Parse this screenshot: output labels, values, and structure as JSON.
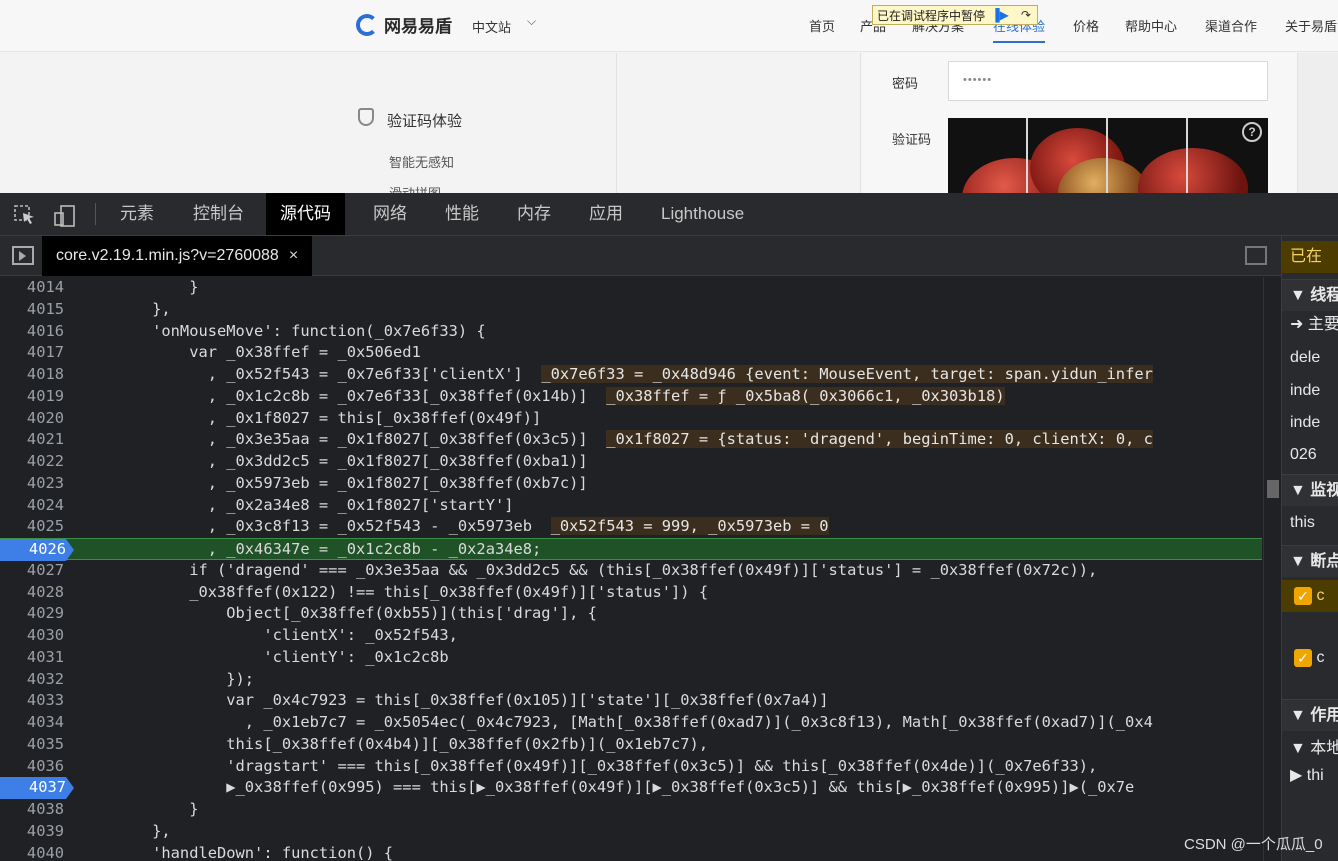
{
  "website": {
    "brand": "网易易盾",
    "lang": "中文站",
    "nav": [
      "首页",
      "产品",
      "解决方案",
      "在线体验",
      "价格",
      "帮助中心",
      "渠道合作",
      "关于易盾"
    ],
    "paused_text": "已在调试程序中暂停",
    "menu_title": "验证码体验",
    "menu_items": [
      "智能无感知",
      "滑动拼图"
    ],
    "password_label": "密码",
    "password_value": "••••••",
    "captcha_label": "验证码"
  },
  "devtools": {
    "tabs": [
      "元素",
      "控制台",
      "源代码",
      "网络",
      "性能",
      "内存",
      "应用",
      "Lighthouse"
    ],
    "active_tab": "源代码",
    "file_tab": "core.v2.19.1.min.js?v=2760088",
    "close_glyph": "×",
    "code_lines": [
      {
        "n": "4014",
        "t": "            }"
      },
      {
        "n": "4015",
        "t": "        },"
      },
      {
        "n": "4016",
        "t": "        'onMouseMove': function(_0x7e6f33) {"
      },
      {
        "n": "4017",
        "t": "            var _0x38ffef = _0x506ed1"
      },
      {
        "n": "4018",
        "t": "              , _0x52f543 = _0x7e6f33['clientX']",
        "v": "_0x7e6f33 = _0x48d946 {event: MouseEvent, target: span.yidun_infer"
      },
      {
        "n": "4019",
        "t": "              , _0x1c2c8b = _0x7e6f33[_0x38ffef(0x14b)]",
        "v": "_0x38ffef = ƒ _0x5ba8(_0x3066c1, _0x303b18)"
      },
      {
        "n": "4020",
        "t": "              , _0x1f8027 = this[_0x38ffef(0x49f)]"
      },
      {
        "n": "4021",
        "t": "              , _0x3e35aa = _0x1f8027[_0x38ffef(0x3c5)]",
        "v": "_0x1f8027 = {status: 'dragend', beginTime: 0, clientX: 0, c"
      },
      {
        "n": "4022",
        "t": "              , _0x3dd2c5 = _0x1f8027[_0x38ffef(0xba1)]"
      },
      {
        "n": "4023",
        "t": "              , _0x5973eb = _0x1f8027[_0x38ffef(0xb7c)]"
      },
      {
        "n": "4024",
        "t": "              , _0x2a34e8 = _0x1f8027['startY']"
      },
      {
        "n": "4025",
        "t": "              , _0x3c8f13 = _0x52f543 - _0x5973eb",
        "v": "_0x52f543 = 999, _0x5973eb = 0"
      },
      {
        "n": "4026",
        "t": "              , _0x46347e = _0x1c2c8b - _0x2a34e8;",
        "hl": true,
        "bp": true
      },
      {
        "n": "4027",
        "t": "            if ('dragend' === _0x3e35aa && _0x3dd2c5 && (this[_0x38ffef(0x49f)]['status'] = _0x38ffef(0x72c)),"
      },
      {
        "n": "4028",
        "t": "            _0x38ffef(0x122) !== this[_0x38ffef(0x49f)]['status']) {"
      },
      {
        "n": "4029",
        "t": "                Object[_0x38ffef(0xb55)](this['drag'], {"
      },
      {
        "n": "4030",
        "t": "                    'clientX': _0x52f543,"
      },
      {
        "n": "4031",
        "t": "                    'clientY': _0x1c2c8b"
      },
      {
        "n": "4032",
        "t": "                });"
      },
      {
        "n": "4033",
        "t": "                var _0x4c7923 = this[_0x38ffef(0x105)]['state'][_0x38ffef(0x7a4)]"
      },
      {
        "n": "4034",
        "t": "                  , _0x1eb7c7 = _0x5054ec(_0x4c7923, [Math[_0x38ffef(0xad7)](_0x3c8f13), Math[_0x38ffef(0xad7)](_0x4"
      },
      {
        "n": "4035",
        "t": "                this[_0x38ffef(0x4b4)][_0x38ffef(0x2fb)](_0x1eb7c7),"
      },
      {
        "n": "4036",
        "t": "                'dragstart' === this[_0x38ffef(0x49f)][_0x38ffef(0x3c5)] && this[_0x38ffef(0x4de)](_0x7e6f33),"
      },
      {
        "n": "4037",
        "t": "                ▶_0x38ffef(0x995) === this[▶_0x38ffef(0x49f)][▶_0x38ffef(0x3c5)] && this[▶_0x38ffef(0x995)]▶(_0x7e",
        "bp": true
      },
      {
        "n": "4038",
        "t": "            }"
      },
      {
        "n": "4039",
        "t": "        },"
      },
      {
        "n": "4040",
        "t": "        'handleDown': function() {"
      }
    ],
    "right_panel": [
      {
        "label": "已在",
        "kind": "warn"
      },
      {
        "label": "▼ 线程",
        "kind": "sec"
      },
      {
        "label": "➜ 主要",
        "kind": "row"
      },
      {
        "label": "dele",
        "kind": "row"
      },
      {
        "label": "inde",
        "kind": "row"
      },
      {
        "label": "inde",
        "kind": "row"
      },
      {
        "label": "026",
        "kind": "row"
      },
      {
        "label": "▼ 监视",
        "kind": "sec"
      },
      {
        "label": "this",
        "kind": "row"
      },
      {
        "label": "▼ 断点",
        "kind": "sec"
      },
      {
        "label": "c",
        "kind": "cbwarn"
      },
      {
        "label": "",
        "kind": "row"
      },
      {
        "label": "c",
        "kind": "cb"
      },
      {
        "label": "",
        "kind": "row"
      },
      {
        "label": "▼ 作用",
        "kind": "sec"
      },
      {
        "label": "▼ 本地",
        "kind": "row"
      },
      {
        "label": "▶ thi",
        "kind": "row"
      }
    ]
  },
  "watermark": "CSDN @一个瓜瓜_0"
}
